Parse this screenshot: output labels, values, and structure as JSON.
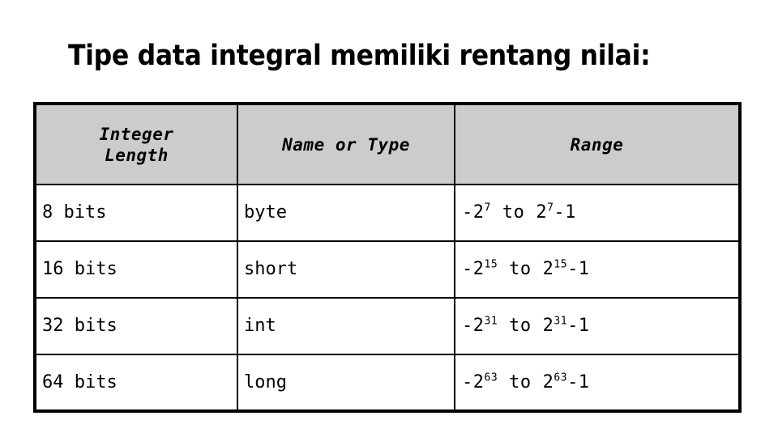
{
  "slide": {
    "title": "Tipe data integral memiliki rentang nilai:",
    "background_color": "#ffffff",
    "text_color": "#000000"
  },
  "table": {
    "header_background": "#cccccc",
    "border_color": "#000000",
    "columns": [
      {
        "key": "length",
        "label": "Integer\nLength"
      },
      {
        "key": "name",
        "label": "Name or Type"
      },
      {
        "key": "range",
        "label": "Range"
      }
    ],
    "rows": [
      {
        "length": "8 bits",
        "name": "byte",
        "range_text": "-2^7  to  2^7-1",
        "range": {
          "lower_base": "-2",
          "lower_exp": "7",
          "to": "to",
          "upper_base": "2",
          "upper_exp": "7",
          "upper_suffix": "-1"
        }
      },
      {
        "length": "16 bits",
        "name": "short",
        "range_text": "-2^15  to  2^15-1",
        "range": {
          "lower_base": "-2",
          "lower_exp": "15",
          "to": "to",
          "upper_base": "2",
          "upper_exp": "15",
          "upper_suffix": "-1"
        }
      },
      {
        "length": "32 bits",
        "name": "int",
        "range_text": "-2^31  to  2^31-1",
        "range": {
          "lower_base": "-2",
          "lower_exp": "31",
          "to": "to",
          "upper_base": "2",
          "upper_exp": "31",
          "upper_suffix": "-1"
        }
      },
      {
        "length": "64 bits",
        "name": "long",
        "range_text": "-2^63  to  2^63-1",
        "range": {
          "lower_base": "-2",
          "lower_exp": "63",
          "to": "to",
          "upper_base": "2",
          "upper_exp": "63",
          "upper_suffix": "-1"
        }
      }
    ]
  }
}
